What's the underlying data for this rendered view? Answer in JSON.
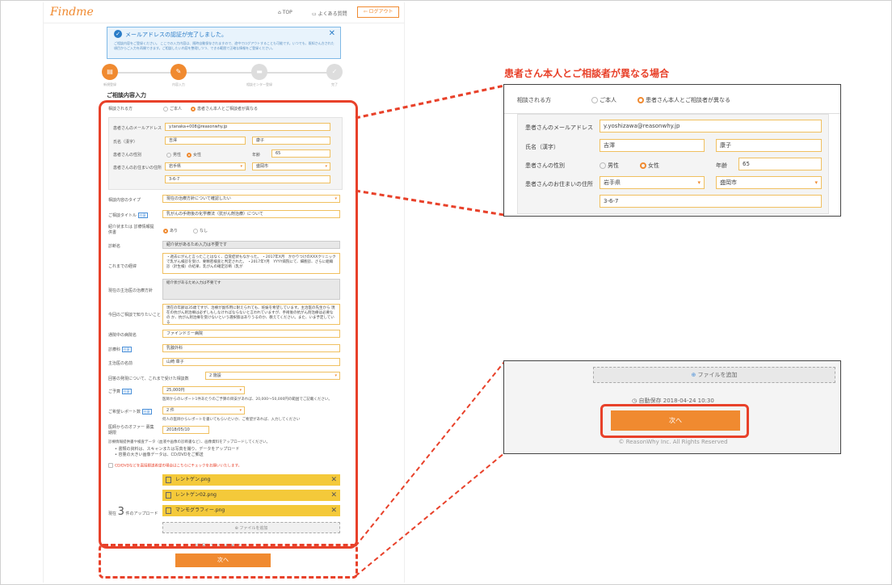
{
  "header": {
    "logo": "Findme",
    "top": "TOP",
    "faq": "よくある質問",
    "logout": "ログアウト"
  },
  "notice": {
    "title": "メールアドレスの認証が完了しました。",
    "body": "ご相談内容をご登録ください。 ここでの入力内容は、随時自動保存されますので、途中でログアウトすることも可能です。いつでも、既知さん方された項目からご入力を再開できます。ご相談したい内容を整理しつつ、できる範囲で正確な情報をご登録ください。"
  },
  "steps": [
    "新規登録",
    "内容入力",
    "相談センター登録",
    "完了"
  ],
  "section_title": "ご相談内容入力",
  "form": {
    "consult_label": "相談される方",
    "opt_self": "ご本人",
    "opt_other": "患者さん本人とご相談者が異なる",
    "email_label": "患者さんのメールアドレス",
    "email": "y.tanaka+008@reasonwhy.jp",
    "name_label": "氏名（漢字）",
    "last": "吉澤",
    "first": "康子",
    "sex_label": "患者さんの性別",
    "male": "男性",
    "female": "女性",
    "age_label": "年齢",
    "age": "65",
    "addr_label": "患者さんのお住まいの住所",
    "pref": "岩手県",
    "city": "盛岡市",
    "street": "3-6-7",
    "type_label": "相談内容のタイプ",
    "type": "現在の治療方針について確認したい",
    "title_label": "ご相談タイトル",
    "title_tag": "任意",
    "title": "乳がんの手術後の化学療法（抗がん剤治療）について",
    "intro_label": "紹介状または 診療情報提供書",
    "yes": "あり",
    "no": "なし",
    "diag_label": "診断名",
    "diag": "紹介状があるため入力は不要です",
    "history_label": "これまでの経緯",
    "history": "・週去にがんと言ったことはなく、自覚症状もなかった。 ・2017年X月　かかりつけのXXXクリニックで乳がん検診を受け、要精密検査と判定された。 ・2017年Y月　YYYY病院にて、細胞診、さらに組織診（針生検）の結果、乳がんの確定診断（乳が",
    "current_label": "現在の主治医の治療方針",
    "current": "紹介状があるため入力は不要です",
    "want_label": "今回のご相談で知りたいこと",
    "want": "現在の年齢は35歳ですが、治療が副作用に耐えられても、妊娠を希望しています。主治医の先生から 現在の抗がん剤治療は必ずしもしなければならないと言われていますが、手術後の抗がん剤治療は必要なの か、抗がん剤治療を受けないという選択肢はありうるのか、教えてください。また、いま予定している",
    "hosp_label": "通院中の病院名",
    "hosp": "ファインドミー病院",
    "dept_label": "診療科",
    "dept_tag": "任意",
    "dept": "乳腺外科",
    "doctor_label": "主治医の名前",
    "doctor": "山崎 章子",
    "reports_label": "回答の発現について、これまで受けた相談数",
    "reports": "2 施設",
    "budget_label": "ご予算",
    "budget_tag": "任意",
    "budget": "25,000円",
    "budget_note": "医師からのレポート1件あたりのご予算の目安があれば、20,000〜50,000円の範囲でご記載ください。",
    "hope_label": "ご希望レポート数",
    "hope_tag": "任意",
    "hope": "2 件",
    "hope_note": "何人の医師からレポートを書いてもらいたいか、ご希望があれば、入力してください",
    "offer_label": "医師からのオファー 募集期限",
    "offer": "2018/05/10",
    "upload_note1": "診療情報提供書や検査データ（血液や画像の診断書など）、画像資料をアップロードしてください。",
    "upload_note2": "• 書類の資料は、スキャンまたは写真を撮り、データをアップロード",
    "upload_note3": "• 容量の大きい画像データは、CD/DVDをご郵送",
    "cd_note": "CD/DVDなどを直接郵送希望の場合はこちらにチェックをお願いいたします。",
    "upload_count_prefix": "現在",
    "upload_count": "3",
    "upload_count_suffix": "件のアップロード",
    "files": [
      "レントゲン.png",
      "レントゲン02.png",
      "マンモグラフィー.png"
    ],
    "add_file": "ファイルを追加",
    "autosave": "自動保存 2018-04-24 10:30",
    "next": "次へ"
  },
  "callout": {
    "title": "患者さん本人とご相談者が異なる場合",
    "email": "y.yoshizawa@reasonwhy.jp",
    "add_file": "ファイルを追加",
    "autosave": "自動保存 2018-04-24 10:30",
    "next": "次へ",
    "copyright": "© ReasonWhy Inc. All Rights Reserved"
  }
}
